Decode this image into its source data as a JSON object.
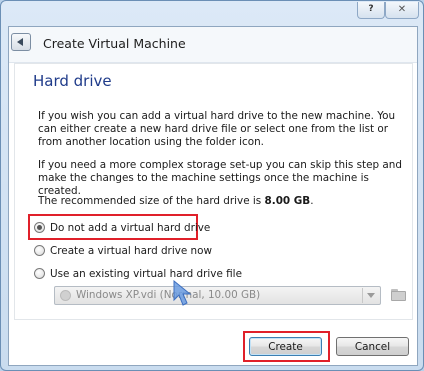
{
  "titlebar": {
    "help_label": "?",
    "close_label": "✕"
  },
  "header": {
    "title": "Create Virtual Machine",
    "back_icon": "back-arrow-icon"
  },
  "section": {
    "title": "Hard drive"
  },
  "paragraphs": {
    "p1": "If you wish you can add a virtual hard drive to the new machine. You can either create a new hard drive file or select one from the list or from another location using the folder icon.",
    "p2": "If you need a more complex storage set-up you can skip this step and make the changes to the machine settings once the machine is created.",
    "p3_prefix": "The recommended size of the hard drive is ",
    "p3_size": "8.00 GB",
    "p3_suffix": "."
  },
  "options": [
    {
      "label": "Do not add a virtual hard drive",
      "checked": true
    },
    {
      "label": "Create a virtual hard drive now",
      "checked": false
    },
    {
      "label": "Use an existing virtual hard drive file",
      "checked": false
    }
  ],
  "existing_disk": {
    "selected": "Windows XP.vdi (Normal, 10.00 GB)",
    "disk_icon": "disk-icon",
    "folder_icon": "folder-icon"
  },
  "buttons": {
    "create": "Create",
    "cancel": "Cancel"
  },
  "colors": {
    "title_blue": "#1f3b8a",
    "highlight_red": "#e0202a",
    "cursor_blue": "#6a9be0"
  }
}
